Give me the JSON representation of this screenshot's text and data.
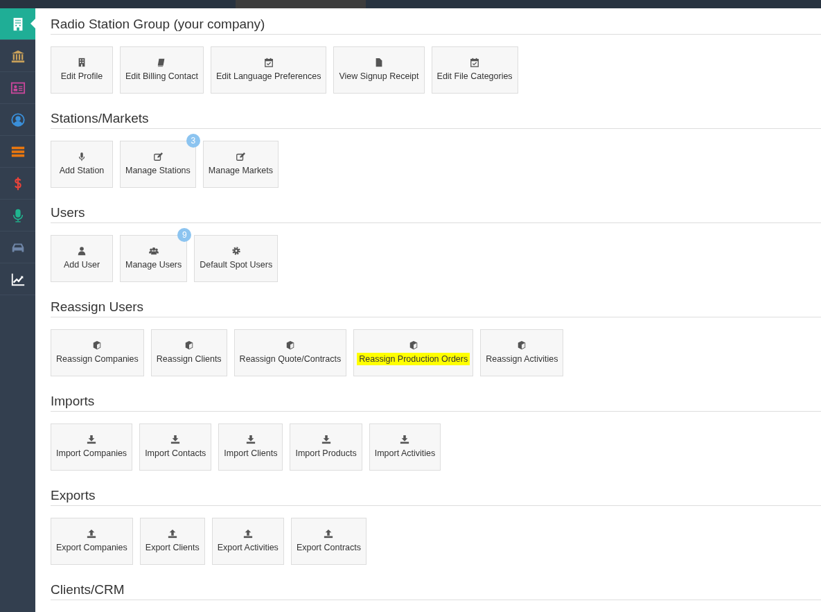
{
  "sidebar": {
    "items": [
      {
        "color": "#ffffff",
        "selected": true
      },
      {
        "color": "#c9a15a",
        "selected": false
      },
      {
        "color": "#c8479a",
        "selected": false
      },
      {
        "color": "#3a8fd9",
        "selected": false
      },
      {
        "color": "#e8760f",
        "selected": false
      },
      {
        "color": "#e8433a",
        "selected": false
      },
      {
        "color": "#1fb58f",
        "selected": false
      },
      {
        "color": "#6f86a8",
        "selected": false
      },
      {
        "color": "#ffffff",
        "selected": false
      }
    ]
  },
  "sections": [
    {
      "title": "Radio Station Group (your company)",
      "tiles": [
        {
          "label": "Edit Profile",
          "kind": "building",
          "highlighted": false
        },
        {
          "label": "Edit Billing Contact",
          "kind": "book",
          "highlighted": false
        },
        {
          "label": "Edit Language Preferences",
          "kind": "calendar",
          "highlighted": false
        },
        {
          "label": "View Signup Receipt",
          "kind": "file",
          "highlighted": false
        },
        {
          "label": "Edit File Categories",
          "kind": "calendar",
          "highlighted": false
        }
      ]
    },
    {
      "title": "Stations/Markets",
      "tiles": [
        {
          "label": "Add Station",
          "kind": "mic",
          "highlighted": false
        },
        {
          "label": "Manage Stations",
          "kind": "edit",
          "badge": "3",
          "highlighted": false
        },
        {
          "label": "Manage Markets",
          "kind": "edit",
          "highlighted": false
        }
      ]
    },
    {
      "title": "Users",
      "tiles": [
        {
          "label": "Add User",
          "kind": "user",
          "highlighted": false
        },
        {
          "label": "Manage Users",
          "kind": "users",
          "badge": "9",
          "highlighted": false
        },
        {
          "label": "Default Spot Users",
          "kind": "gear",
          "highlighted": false
        }
      ]
    },
    {
      "title": "Reassign Users",
      "tiles": [
        {
          "label": "Reassign Companies",
          "kind": "cube",
          "highlighted": false
        },
        {
          "label": "Reassign Clients",
          "kind": "cube",
          "highlighted": false
        },
        {
          "label": "Reassign Quote/Contracts",
          "kind": "cube",
          "highlighted": false
        },
        {
          "label": "Reassign Production Orders",
          "kind": "cube",
          "highlighted": true
        },
        {
          "label": "Reassign Activities",
          "kind": "cube",
          "highlighted": false
        }
      ]
    },
    {
      "title": "Imports",
      "tiles": [
        {
          "label": "Import Companies",
          "kind": "download",
          "highlighted": false
        },
        {
          "label": "Import Contacts",
          "kind": "download",
          "highlighted": false
        },
        {
          "label": "Import Clients",
          "kind": "download",
          "highlighted": false
        },
        {
          "label": "Import Products",
          "kind": "download",
          "highlighted": false
        },
        {
          "label": "Import Activities",
          "kind": "download",
          "highlighted": false
        }
      ]
    },
    {
      "title": "Exports",
      "tiles": [
        {
          "label": "Export Companies",
          "kind": "upload",
          "highlighted": false
        },
        {
          "label": "Export Clients",
          "kind": "upload",
          "highlighted": false
        },
        {
          "label": "Export Activities",
          "kind": "upload",
          "highlighted": false
        },
        {
          "label": "Export Contracts",
          "kind": "upload",
          "highlighted": false
        }
      ]
    },
    {
      "title": "Clients/CRM"
    }
  ]
}
